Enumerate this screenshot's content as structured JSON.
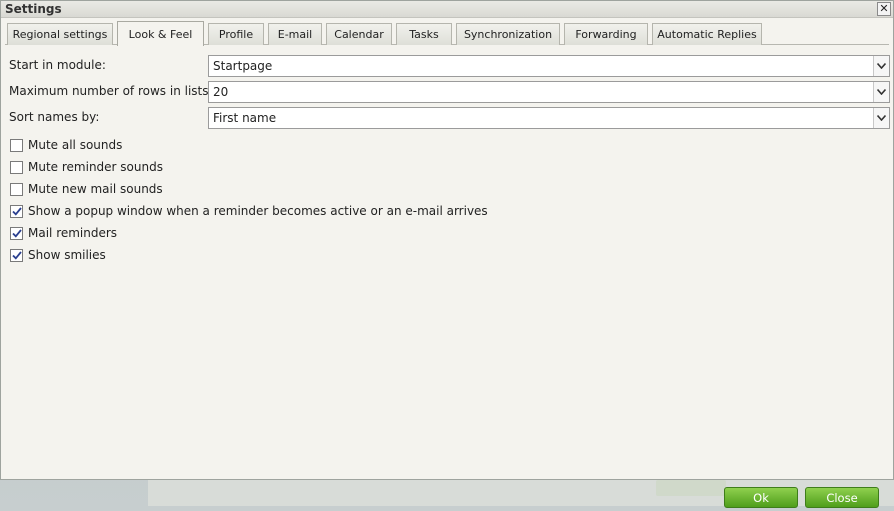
{
  "dialog": {
    "title": "Settings",
    "close_glyph": "✕"
  },
  "tabs": [
    {
      "label": "Regional settings",
      "active": false
    },
    {
      "label": "Look & Feel",
      "active": true
    },
    {
      "label": "Profile",
      "active": false
    },
    {
      "label": "E-mail",
      "active": false
    },
    {
      "label": "Calendar",
      "active": false
    },
    {
      "label": "Tasks",
      "active": false
    },
    {
      "label": "Synchronization",
      "active": false
    },
    {
      "label": "Forwarding",
      "active": false
    },
    {
      "label": "Automatic Replies",
      "active": false
    }
  ],
  "form": {
    "start_module": {
      "label": "Start in module:",
      "value": "Startpage"
    },
    "max_rows": {
      "label": "Maximum number of rows in lists:",
      "value": "20"
    },
    "sort_names": {
      "label": "Sort names by:",
      "value": "First name"
    }
  },
  "checkboxes": [
    {
      "label": "Mute all sounds",
      "checked": false
    },
    {
      "label": "Mute reminder sounds",
      "checked": false
    },
    {
      "label": "Mute new mail sounds",
      "checked": false
    },
    {
      "label": "Show a popup window when a reminder becomes active or an e-mail arrives",
      "checked": true
    },
    {
      "label": "Mail reminders",
      "checked": true
    },
    {
      "label": "Show smilies",
      "checked": true
    }
  ],
  "footer": {
    "ok_label": "Ok",
    "close_label": "Close"
  },
  "colors": {
    "button_green": "#5fae2a",
    "dialog_bg": "#f4f3ee"
  }
}
